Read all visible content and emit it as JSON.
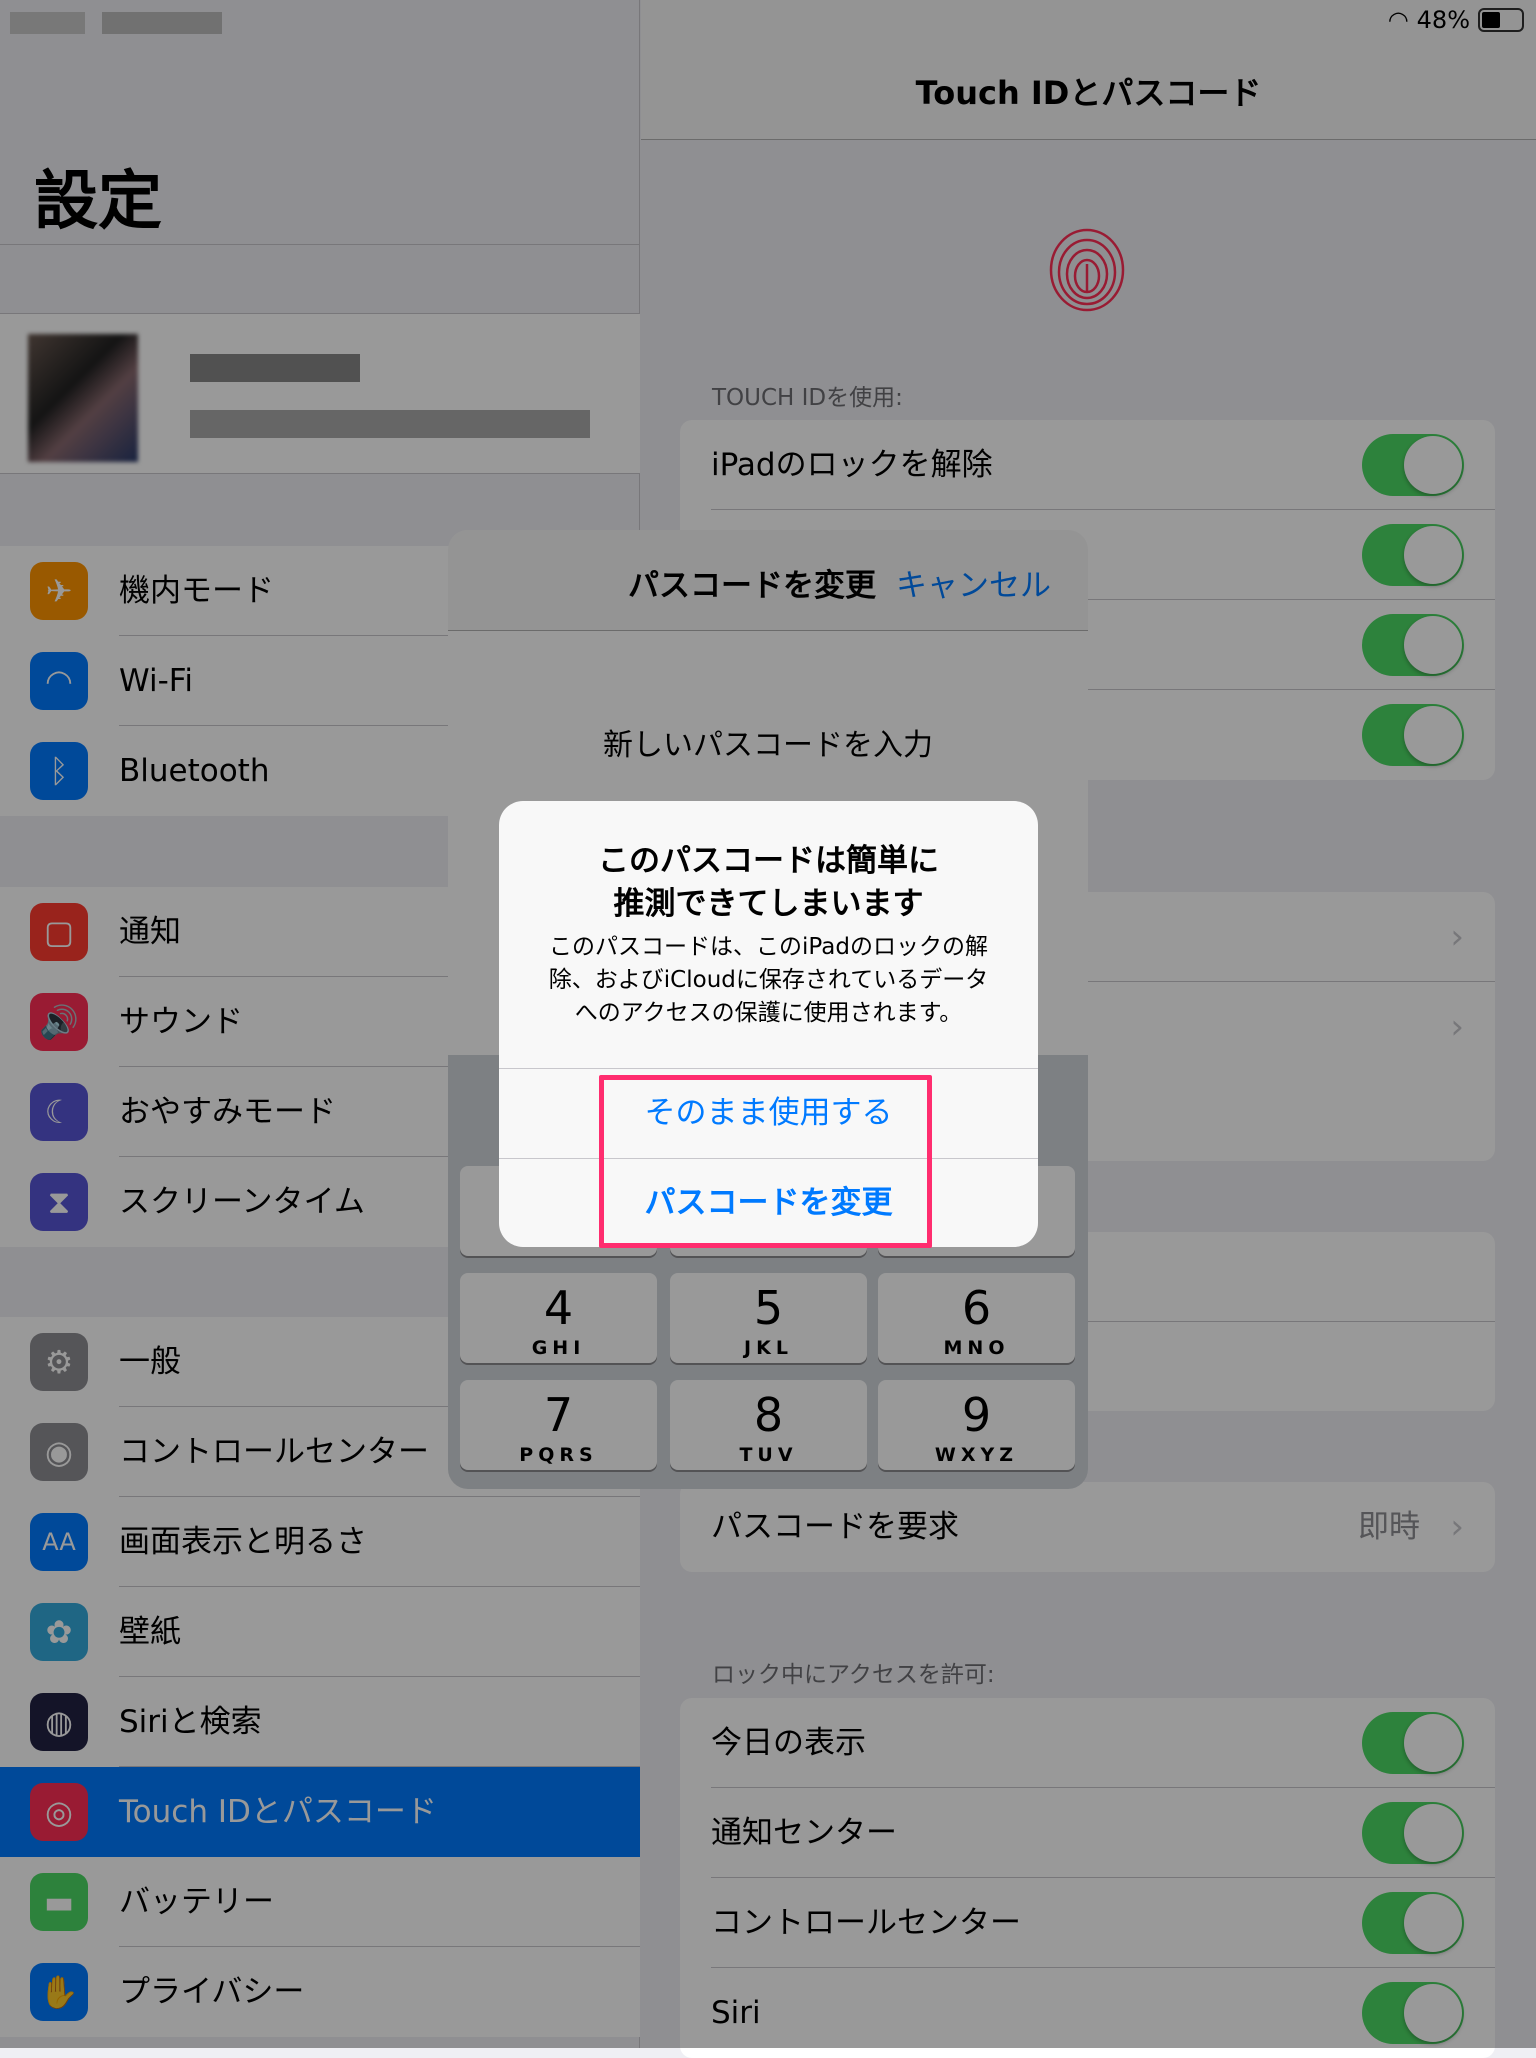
{
  "status_bar": {
    "wifi_icon": "wifi-icon",
    "battery_percent": "48%",
    "battery_level": 0.48
  },
  "sidebar": {
    "title": "設定",
    "groups": [
      [
        {
          "label": "機内モード",
          "icon": "airplane-icon",
          "glyph": "✈",
          "color": "#ff9500"
        },
        {
          "label": "Wi-Fi",
          "icon": "wifi-icon",
          "glyph": "◠",
          "color": "#007aff"
        },
        {
          "label": "Bluetooth",
          "icon": "bluetooth-icon",
          "glyph": "ᛒ",
          "color": "#007aff"
        }
      ],
      [
        {
          "label": "通知",
          "icon": "notifications-icon",
          "glyph": "▢",
          "color": "#ff3b30"
        },
        {
          "label": "サウンド",
          "icon": "sound-icon",
          "glyph": "🔊",
          "color": "#ff2d55"
        },
        {
          "label": "おやすみモード",
          "icon": "moon-icon",
          "glyph": "☾",
          "color": "#5856d6"
        },
        {
          "label": "スクリーンタイム",
          "icon": "hourglass-icon",
          "glyph": "⧗",
          "color": "#5856d6"
        }
      ],
      [
        {
          "label": "一般",
          "icon": "gear-icon",
          "glyph": "⚙",
          "color": "#8e8e93"
        },
        {
          "label": "コントロールセンター",
          "icon": "toggles-icon",
          "glyph": "◉",
          "color": "#8e8e93"
        },
        {
          "label": "画面表示と明るさ",
          "icon": "text-size-icon",
          "glyph": "AA",
          "color": "#007aff"
        },
        {
          "label": "壁紙",
          "icon": "flower-icon",
          "glyph": "✿",
          "color": "#34aadc"
        },
        {
          "label": "Siriと検索",
          "icon": "siri-icon",
          "glyph": "◍",
          "color": "#222244"
        },
        {
          "label": "Touch IDとパスコード",
          "icon": "fingerprint-icon",
          "glyph": "◎",
          "color": "#ff2d55",
          "selected": true
        },
        {
          "label": "バッテリー",
          "icon": "battery-icon",
          "glyph": "▬",
          "color": "#4cd964"
        },
        {
          "label": "プライバシー",
          "icon": "hand-icon",
          "glyph": "✋",
          "color": "#007aff"
        }
      ]
    ]
  },
  "detail": {
    "title": "Touch IDとパスコード",
    "fingerprint_icon": "fingerprint-icon",
    "touch_id_header": "TOUCH IDを使用:",
    "touch_id_rows": [
      {
        "label": "iPadのロックを解除",
        "on": true
      },
      {
        "label": "",
        "on": true
      },
      {
        "label": "",
        "on": true
      },
      {
        "label": "",
        "on": true
      }
    ],
    "require_passcode": {
      "label": "パスコードを要求",
      "value": "即時"
    },
    "lock_access_header": "ロック中にアクセスを許可:",
    "lock_access_rows": [
      {
        "label": "今日の表示",
        "on": true
      },
      {
        "label": "通知センター",
        "on": true
      },
      {
        "label": "コントロールセンター",
        "on": true
      },
      {
        "label": "Siri",
        "on": true
      }
    ]
  },
  "sheet": {
    "title": "パスコードを変更",
    "cancel": "キャンセル",
    "prompt": "新しいパスコードを入力",
    "keys": [
      {
        "digit": "4",
        "letters": "GHI"
      },
      {
        "digit": "5",
        "letters": "JKL"
      },
      {
        "digit": "6",
        "letters": "MNO"
      },
      {
        "digit": "7",
        "letters": "PQRS"
      },
      {
        "digit": "8",
        "letters": "TUV"
      },
      {
        "digit": "9",
        "letters": "WXYZ"
      }
    ]
  },
  "alert": {
    "title_line1": "このパスコードは簡単に",
    "title_line2": "推測できてしまいます",
    "body_line1": "このパスコードは、このiPadのロックの解",
    "body_line2": "除、およびiCloudに保存されているデータ",
    "body_line3": "へのアクセスの保護に使用されます。",
    "use_anyway": "そのまま使用する",
    "change": "パスコードを変更",
    "highlight_color": "#ff2d6f"
  }
}
